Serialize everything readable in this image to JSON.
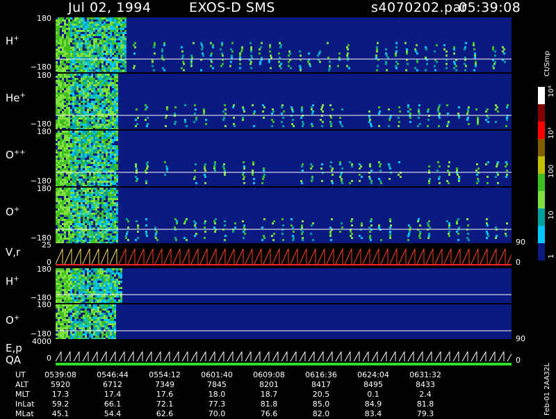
{
  "header": {
    "date": "Jul 02, 1994",
    "mission": "EXOS-D SMS",
    "file": "s4070202.par",
    "time": "05:39:08"
  },
  "panels": [
    {
      "label_main": "H",
      "label_sup": "+",
      "top_tick": "180",
      "bottom_tick": "−180"
    },
    {
      "label_main": "He",
      "label_sup": "+",
      "top_tick": "180",
      "bottom_tick": "−180"
    },
    {
      "label_main": "O",
      "label_sup": "++",
      "top_tick": "180",
      "bottom_tick": "−180"
    },
    {
      "label_main": "O",
      "label_sup": "+",
      "top_tick": "180",
      "bottom_tick": "−180"
    },
    {
      "label_main": "V,r",
      "label_sup": "",
      "top_tick": "25",
      "bottom_tick": "0",
      "right_top": "90",
      "right_bottom": "0"
    },
    {
      "label_main": "H",
      "label_sup": "+",
      "top_tick": "180",
      "bottom_tick": "−180"
    },
    {
      "label_main": "O",
      "label_sup": "+",
      "top_tick": "180",
      "bottom_tick": "−180"
    },
    {
      "label_main": "E,p",
      "label_sup": "",
      "label2": "QA",
      "top_tick": "4000",
      "bottom_tick": "0",
      "right_top": "90",
      "right_bottom": "0"
    }
  ],
  "colorbar": {
    "unit": "Ct/Smp",
    "labels": [
      "1",
      "10",
      "100",
      "10³",
      "10⁴"
    ],
    "colors": [
      "#0a1a80",
      "#00c8ff",
      "#00a0a0",
      "#80e040",
      "#40c020",
      "#c0c000",
      "#806000",
      "#ff0000",
      "#800000",
      "#ffffff"
    ]
  },
  "ephemeris": {
    "row_labels": [
      "UT",
      "ALT",
      "MLT",
      "InLat",
      "MLat"
    ],
    "columns": [
      {
        "UT": "0539:08",
        "ALT": "5920",
        "MLT": "17.3",
        "InLat": "59.2",
        "MLat": "45.1"
      },
      {
        "UT": "0546:44",
        "ALT": "6712",
        "MLT": "17.4",
        "InLat": "66.1",
        "MLat": "54.4"
      },
      {
        "UT": "0554:12",
        "ALT": "7349",
        "MLT": "17.6",
        "InLat": "72.1",
        "MLat": "62.6"
      },
      {
        "UT": "0601:40",
        "ALT": "7845",
        "MLT": "18.0",
        "InLat": "77.3",
        "MLat": "70.0"
      },
      {
        "UT": "0609:08",
        "ALT": "8201",
        "MLT": "18.7",
        "InLat": "81.8",
        "MLat": "76.6"
      },
      {
        "UT": "0616:36",
        "ALT": "8417",
        "MLT": "20.5",
        "InLat": "85.0",
        "MLat": "82.0"
      },
      {
        "UT": "0624:04",
        "ALT": "8495",
        "MLT": "0.1",
        "InLat": "84.9",
        "MLat": "83.4"
      },
      {
        "UT": "0631:32",
        "ALT": "8433",
        "MLT": "2.4",
        "InLat": "81.8",
        "MLat": "79.3"
      }
    ]
  },
  "footer": "Feb-01 2AA32L"
}
